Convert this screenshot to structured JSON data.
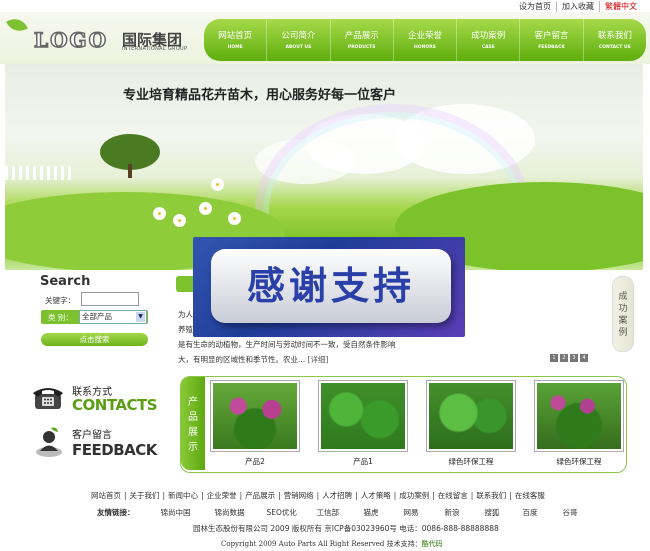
{
  "topbar": {
    "home": "设为首页",
    "fav": "加入收藏",
    "lang": "繁體中文"
  },
  "logo": {
    "text": "LOGO",
    "cn": "国际集团",
    "en": "INTERNATIONAL GROUP"
  },
  "nav": [
    {
      "cn": "网站首页",
      "en": "HOME"
    },
    {
      "cn": "公司简介",
      "en": "ABOUT US"
    },
    {
      "cn": "产品展示",
      "en": "PRODUCTS"
    },
    {
      "cn": "企业荣誉",
      "en": "HONORS"
    },
    {
      "cn": "成功案例",
      "en": "CASE"
    },
    {
      "cn": "客户留言",
      "en": "FEEDBACK"
    },
    {
      "cn": "联系我们",
      "en": "CONTACT US"
    }
  ],
  "banner": {
    "slogan": "专业培育精品花卉苗木，用心服务好每一位客户"
  },
  "search": {
    "title": "Search",
    "keyword_label": "关键字：",
    "keyword_value": "",
    "category_label": "类    别：",
    "category_value": "全部产品",
    "button": "点击搜索"
  },
  "content": {
    "line1": "为人",
    "line2": "养殖",
    "line3": "是有生命的动植物，生产时间与劳动时间不一致，受自然条件影响",
    "line4": "大，有明显的区域性和季节性。农业...",
    "more": "[详细]",
    "pages": [
      "1",
      "2",
      "3",
      "4"
    ]
  },
  "side_tab": {
    "label": "成功案例"
  },
  "overlay": {
    "text": "感谢支持"
  },
  "contacts": {
    "cn": "联系方式",
    "en": "CONTACTS"
  },
  "feedback": {
    "cn": "客户留言",
    "en": "FEEDBACK"
  },
  "products": {
    "tab": "产品展示",
    "items": [
      {
        "caption": "产品2"
      },
      {
        "caption": "产品1"
      },
      {
        "caption": "绿色环保工程"
      },
      {
        "caption": "绿色环保工程"
      }
    ]
  },
  "footer": {
    "links": [
      "网站首页",
      "关于我们",
      "新闻中心",
      "企业荣誉",
      "产品展示",
      "营销网络",
      "人才招聘",
      "人才策略",
      "成功案例",
      "在线留言",
      "联系我们",
      "在线客服"
    ],
    "friend_label": "友情链接：",
    "friends": [
      "锦尚中国",
      "锦尚数据",
      "SEO优化",
      "工信部",
      "猫虎",
      "网易",
      "新浪",
      "搜狐",
      "百度",
      "谷哥"
    ],
    "company": "园林生态股份有限公司 2009 版权所有 京ICP备03023960号 电话：0086-888-88888888",
    "copyright": "Copyright 2009 Auto Parts All Right Reserved 技术支持：",
    "brand": "酷代码"
  },
  "colors": {
    "accent": "#6db31c",
    "overlay": "#2a3fa8",
    "lang": "#cc0000"
  }
}
